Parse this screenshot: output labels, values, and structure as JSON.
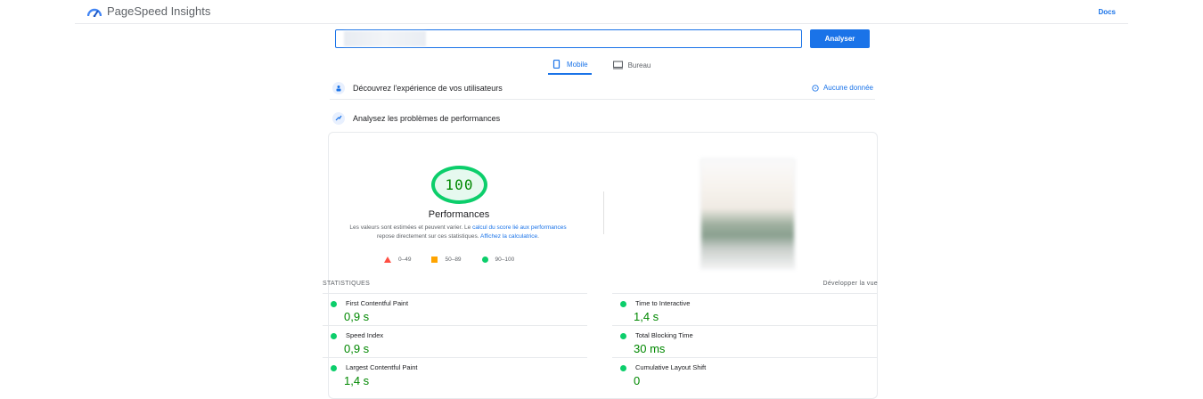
{
  "app": {
    "title": "PageSpeed Insights",
    "docs_label": "Docs"
  },
  "search": {
    "value": "",
    "button_label": "Analyser"
  },
  "tabs": [
    {
      "label": "Mobile",
      "active": true,
      "icon": "phone-icon"
    },
    {
      "label": "Bureau",
      "active": false,
      "icon": "desktop-icon"
    }
  ],
  "sections": {
    "field": {
      "title": "Découvrez l'expérience de vos utilisateurs",
      "status": "Aucune donnée"
    },
    "lab": {
      "title": "Analysez les problèmes de performances"
    }
  },
  "performance": {
    "score": "100",
    "title": "Performances",
    "note_prefix": "Les valeurs sont estimées et peuvent varier. Le ",
    "note_link1": "calcul du score lié aux performances",
    "note_middle": " repose directement sur ces statistiques. ",
    "note_link2": "Affichez la calculatrice",
    "note_suffix": ".",
    "legend": [
      {
        "label": "0–49",
        "color": "#ff4e42"
      },
      {
        "label": "50–89",
        "color": "#ffa400"
      },
      {
        "label": "90–100",
        "color": "#0cce6b"
      }
    ]
  },
  "stats": {
    "header": "STATISTIQUES",
    "expand_label": "Développer la vue",
    "metrics": [
      {
        "name": "First Contentful Paint",
        "value": "0,9 s"
      },
      {
        "name": "Time to Interactive",
        "value": "1,4 s"
      },
      {
        "name": "Speed Index",
        "value": "0,9 s"
      },
      {
        "name": "Total Blocking Time",
        "value": "30 ms"
      },
      {
        "name": "Largest Contentful Paint",
        "value": "1,4 s"
      },
      {
        "name": "Cumulative Layout Shift",
        "value": "0"
      }
    ]
  },
  "colors": {
    "accent": "#1a73e8",
    "pass": "#0cce6b",
    "pass_text": "#008800"
  }
}
